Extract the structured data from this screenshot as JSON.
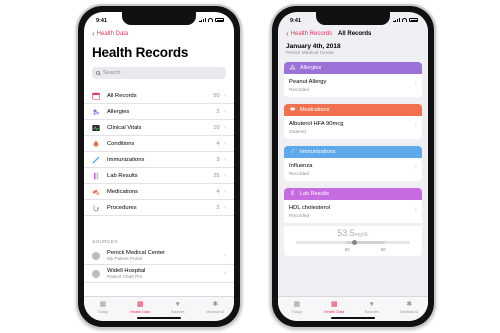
{
  "colors": {
    "accent": "#e8365a",
    "allergies": "#9b72d8",
    "medications": "#f0704f",
    "immunizations": "#5fa8ea",
    "lab_results": "#c76be0"
  },
  "left": {
    "status_time": "9:41",
    "back_label": "Health Data",
    "title": "Health Records",
    "search_placeholder": "Search",
    "rows": [
      {
        "icon": "calendar-icon",
        "label": "All Records",
        "count": "50"
      },
      {
        "icon": "allergy-icon",
        "label": "Allergies",
        "count": "2"
      },
      {
        "icon": "vitals-icon",
        "label": "Clinical Vitals",
        "count": "10"
      },
      {
        "icon": "conditions-icon",
        "label": "Conditions",
        "count": "4"
      },
      {
        "icon": "syringe-icon",
        "label": "Immunizations",
        "count": "3"
      },
      {
        "icon": "lab-icon",
        "label": "Lab Results",
        "count": "25"
      },
      {
        "icon": "pills-icon",
        "label": "Medications",
        "count": "4"
      },
      {
        "icon": "procedures-icon",
        "label": "Procedures",
        "count": "2"
      }
    ],
    "sources_header": "SOURCES",
    "sources": [
      {
        "name": "Penick Medical Center",
        "sub": "My Patient Portal"
      },
      {
        "name": "Widell Hospital",
        "sub": "Patient Chart Pro"
      }
    ],
    "tabs": [
      {
        "icon": "today-icon",
        "label": "Today"
      },
      {
        "icon": "heart-icon",
        "label": "Health Data"
      },
      {
        "icon": "sources-icon",
        "label": "Sources"
      },
      {
        "icon": "medical-id-icon",
        "label": "Medical ID"
      }
    ]
  },
  "right": {
    "status_time": "9:41",
    "back_label": "Health Records",
    "nav_title": "All Records",
    "date": "January 4th, 2018",
    "provider": "Penick Medical Center",
    "cards": [
      {
        "header": "Allergies",
        "icon": "allergy-icon",
        "title": "Peanut Allergy",
        "status": "Recorded"
      },
      {
        "header": "Medications",
        "icon": "pills-icon",
        "title": "Albuterol HFA 90mcg",
        "status": "Ordered"
      },
      {
        "header": "Immunizations",
        "icon": "syringe-icon",
        "title": "Influenza",
        "status": "Recorded"
      },
      {
        "header": "Lab Results",
        "icon": "lab-icon",
        "title": "HDL cholesterol",
        "status": "Recorded"
      }
    ],
    "lab_value": "53.5",
    "lab_unit": "mg/dL",
    "range_low": "50",
    "range_high": "60",
    "tabs": [
      {
        "icon": "today-icon",
        "label": "Today"
      },
      {
        "icon": "heart-icon",
        "label": "Health Data"
      },
      {
        "icon": "sources-icon",
        "label": "Sources"
      },
      {
        "icon": "medical-id-icon",
        "label": "Medical ID"
      }
    ]
  }
}
